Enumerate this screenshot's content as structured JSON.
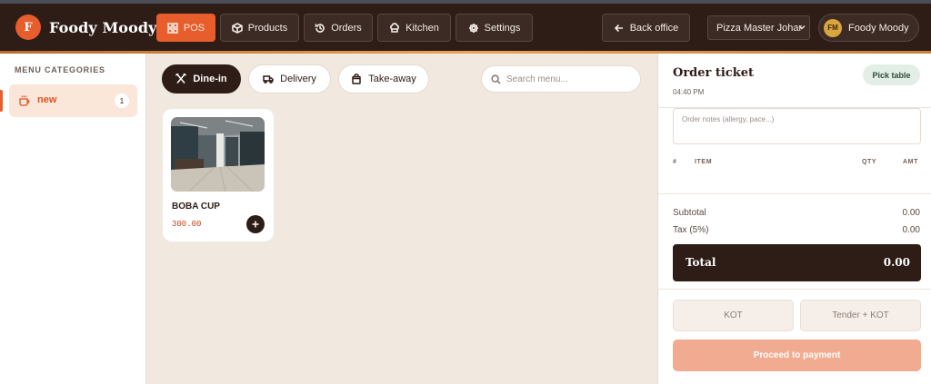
{
  "header": {
    "brand_initial": "F",
    "brand_name": "Foody Moody",
    "nav": [
      {
        "label": "POS",
        "icon": "grid-icon",
        "active": true
      },
      {
        "label": "Products",
        "icon": "box-icon",
        "active": false
      },
      {
        "label": "Orders",
        "icon": "history-icon",
        "active": false
      },
      {
        "label": "Kitchen",
        "icon": "chef-hat-icon",
        "active": false
      },
      {
        "label": "Settings",
        "icon": "gear-icon",
        "active": false
      }
    ],
    "back_office_label": "Back office",
    "store_select_value": "Pizza Master Johar",
    "user_initials": "FM",
    "user_name": "Foody Moody"
  },
  "sidebar": {
    "title": "MENU CATEGORIES",
    "items": [
      {
        "label": "new",
        "count": "1",
        "icon": "coffee-cup-icon",
        "active": true
      }
    ]
  },
  "main": {
    "order_types": [
      {
        "label": "Dine-in",
        "icon": "utensils-icon",
        "active": true
      },
      {
        "label": "Delivery",
        "icon": "truck-icon",
        "active": false
      },
      {
        "label": "Take-away",
        "icon": "shopping-bag-icon",
        "active": false
      }
    ],
    "search_placeholder": "Search menu...",
    "products": [
      {
        "name": "BOBA CUP",
        "price": "300.00"
      }
    ]
  },
  "order": {
    "title": "Order ticket",
    "time": "04:40 PM",
    "pick_table_label": "Pick table",
    "notes_placeholder": "Order notes (allergy, pace...)",
    "columns": {
      "num": "#",
      "item": "ITEM",
      "qty": "QTY",
      "amt": "AMT"
    },
    "subtotal_label": "Subtotal",
    "subtotal_value": "0.00",
    "tax_label": "Tax (5%)",
    "tax_value": "0.00",
    "total_label": "Total",
    "total_value": "0.00",
    "kot_label": "KOT",
    "tender_kot_label": "Tender + KOT",
    "pay_label": "Proceed to payment"
  },
  "colors": {
    "accent": "#e75d2b",
    "header_bg": "#2e1c17",
    "main_bg": "#f1e8e0",
    "pay_disabled": "#f1ab90"
  }
}
